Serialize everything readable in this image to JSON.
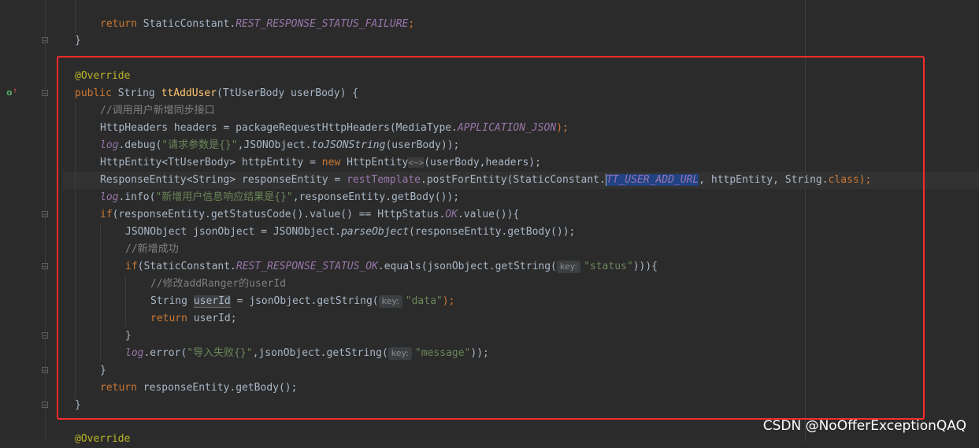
{
  "editor": {
    "lines": {
      "l0_ret": "return",
      "l0_cls": " StaticConstant.",
      "l0_fld": "REST_RESPONSE_STATUS_FAILURE",
      "l0_end": ";",
      "l1": "}",
      "l2_ann": "@Override",
      "l3_kw": "public",
      "l3_type": " String ",
      "l3_fn": "ttAddUser",
      "l3_rest": "(TtUserBody userBody) {",
      "l4": "//调用用户新增同步接口",
      "l5_a": "HttpHeaders headers = packageRequestHttpHeaders(MediaType.",
      "l5_fld": "APPLICATION_JSON",
      "l5_end": ");",
      "l6_log": "log",
      "l6_a": ".debug(",
      "l6_str": "\"请求参数是{}\"",
      "l6_b": ",JSONObject.",
      "l6_it": "toJSONString",
      "l6_end": "(userBody));",
      "l7_a": "HttpEntity<TtUserBody> httpEntity = ",
      "l7_kw": "new",
      "l7_b": " HttpEntity",
      "l7_dia": "<~>",
      "l7_end": "(userBody,headers);",
      "l8_a": "ResponseEntity<String> responseEntity = ",
      "l8_fld": "restTemplate",
      "l8_b": ".postForEntity(StaticConstant.",
      "l8_sf": "TT_USER_ADD_URL",
      "l8_c": ", httpEntity, String.",
      "l8_kw": "class",
      "l8_end": ");",
      "l9_log": "log",
      "l9_a": ".info(",
      "l9_str": "\"新增用户信息响应结果是{}\"",
      "l9_end": ",responseEntity.getBody());",
      "l10_kw": "if",
      "l10_a": "(responseEntity.getStatusCode().value() == HttpStatus.",
      "l10_sf": "OK",
      "l10_end": ".value()){",
      "l11_a": "JSONObject jsonObject = JSONObject.",
      "l11_it": "parseObject",
      "l11_end": "(responseEntity.getBody());",
      "l12": "//新增成功",
      "l13_kw": "if",
      "l13_a": "(StaticConstant.",
      "l13_sf": "REST_RESPONSE_STATUS_OK",
      "l13_b": ".equals(jsonObject.getString(",
      "l13_hint": "key:",
      "l13_str": "\"status\"",
      "l13_end": "))){",
      "l14": "//修改addRanger的userId",
      "l15_a": "String ",
      "l15_var": "userId",
      "l15_b": " = jsonObject.getString(",
      "l15_hint": "key:",
      "l15_str": "\"data\"",
      "l15_end": ");",
      "l16_kw": "return",
      "l16_end": " userId;",
      "l17": "}",
      "l18_log": "log",
      "l18_a": ".error(",
      "l18_str": "\"导入失败{}\"",
      "l18_b": ",jsonObject.getString(",
      "l18_hint": "key:",
      "l18_str2": "\"message\"",
      "l18_end": "));",
      "l19": "}",
      "l20_kw": "return",
      "l20_end": " responseEntity.getBody();",
      "l21": "}",
      "l22_ann": "@Override"
    }
  },
  "watermark": "CSDN @NoOfferExceptionQAQ",
  "colors": {
    "background": "#2b2b2b",
    "keyword": "#cc7832",
    "annotation": "#bbb529",
    "method_decl": "#ffc66d",
    "comment": "#808080",
    "string": "#6a8759",
    "field": "#9876aa",
    "highlight_box": "#ff2a2a"
  },
  "icons": [
    "override-gutter-icon",
    "fold-marker-icon"
  ]
}
